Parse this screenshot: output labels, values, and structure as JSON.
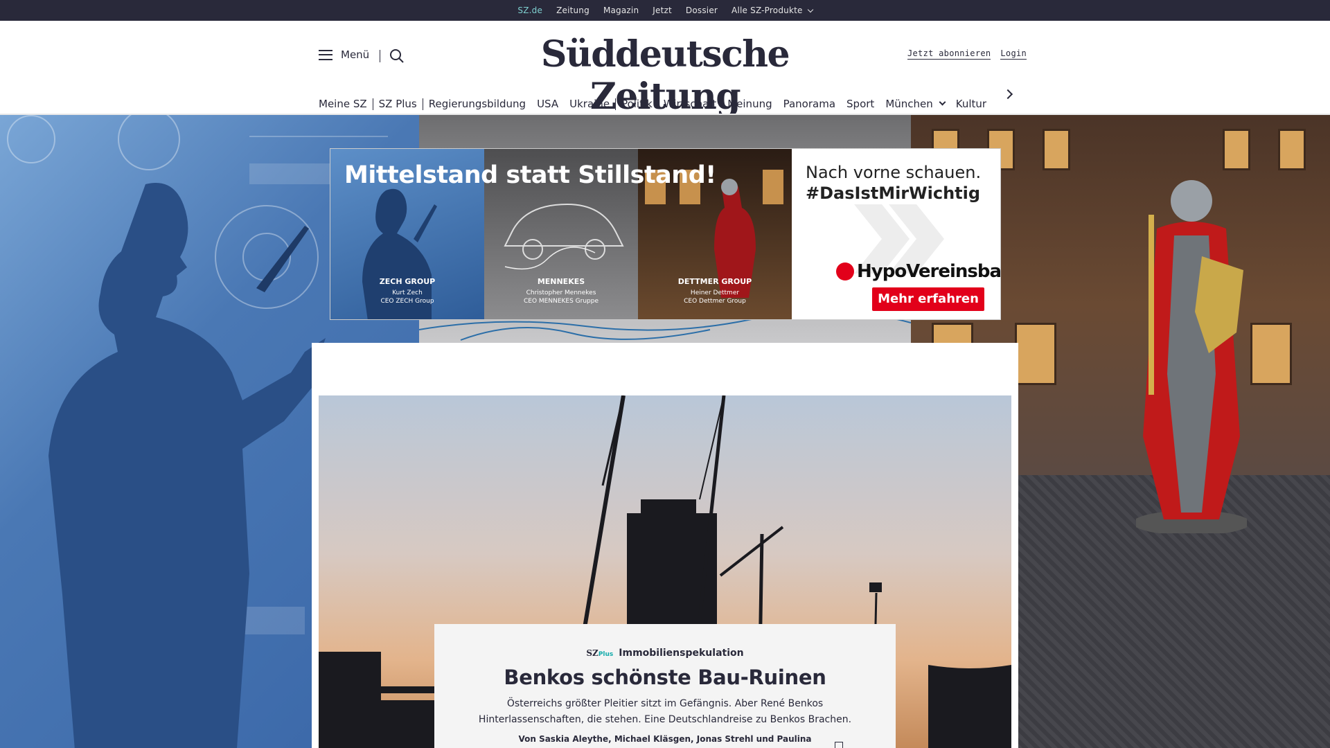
{
  "topbar": {
    "items": [
      "SZ.de",
      "Zeitung",
      "Magazin",
      "Jetzt",
      "Dossier",
      "Alle SZ-Produkte"
    ],
    "active_index": 0
  },
  "header": {
    "menu_label": "Menü",
    "logo": "Süddeutsche Zeitung",
    "subscribe_label": "Jetzt abonnieren",
    "login_label": "Login"
  },
  "nav": {
    "items": [
      "Meine SZ",
      "SZ Plus",
      "Regierungsbildung",
      "USA",
      "Ukraine",
      "Politik",
      "Wirtschaft",
      "Meinung",
      "Panorama",
      "Sport",
      "München",
      "Kultur"
    ]
  },
  "ad": {
    "headline": "Mittelstand statt Stillstand!",
    "panels": [
      {
        "company": "ZECH GROUP",
        "person": "Kurt Zech",
        "role": "CEO ZECH Group"
      },
      {
        "company": "MENNEKES",
        "person": "Christopher Mennekes",
        "role": "CEO MENNEKES Gruppe"
      },
      {
        "company": "DETTMER GROUP",
        "person": "Heiner Dettmer",
        "role": "CEO Dettmer Group"
      }
    ],
    "tagline_1": "Nach vorne schauen.",
    "tagline_2": "#DasIstMirWichtig",
    "brand": "HypoVereinsbank",
    "cta": "Mehr erfahren"
  },
  "teaser": {
    "plus_label": "SZ",
    "plus_suffix": "Plus",
    "kicker": "Immobilienspekulation",
    "title": "Benkos schönste Bau-Ruinen",
    "text": "Österreichs größter Pleitier sitzt im Gefängnis. Aber René Benkos Hinterlassenschaften, die stehen. Eine Deutschlandreise zu Benkos Brachen.",
    "author": "Von Saskia Aleythe, Michael Kläsgen, Jonas Strehl und Paulina"
  },
  "colors": {
    "dark": "#29293a",
    "accent": "#7fd0d0",
    "ad_red": "#e2001a"
  }
}
